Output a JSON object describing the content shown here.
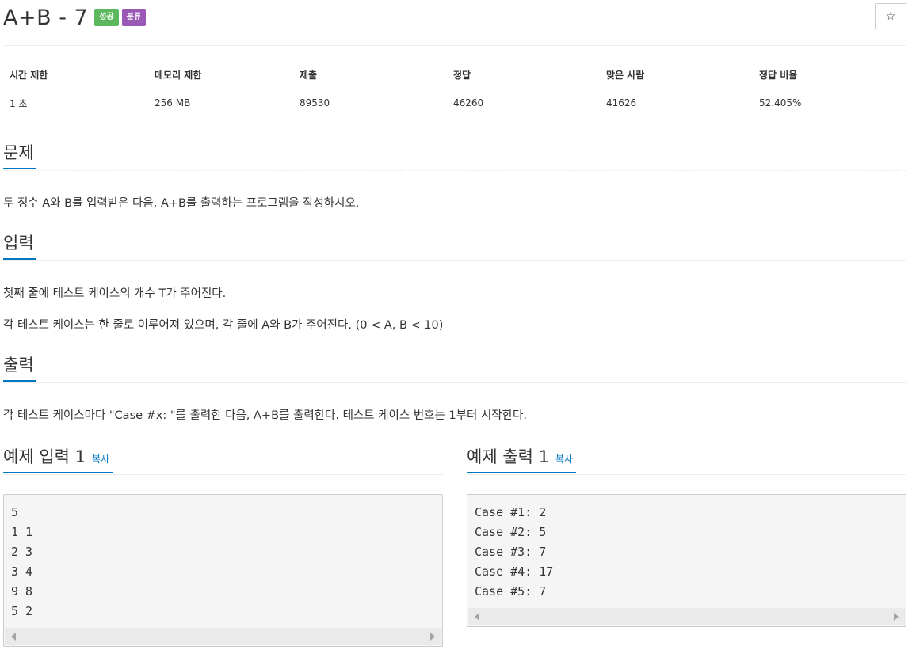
{
  "problem": {
    "title": "A+B - 7",
    "badges": {
      "success": "성공",
      "category": "분류"
    },
    "star_icon": "☆"
  },
  "stats": {
    "headers": [
      "시간 제한",
      "메모리 제한",
      "제출",
      "정답",
      "맞은 사람",
      "정답 비율"
    ],
    "values": [
      "1 초",
      "256 MB",
      "89530",
      "46260",
      "41626",
      "52.405%"
    ]
  },
  "sections": {
    "problem": {
      "heading": "문제",
      "text": "두 정수 A와 B를 입력받은 다음, A+B를 출력하는 프로그램을 작성하시오."
    },
    "input": {
      "heading": "입력",
      "lines": [
        "첫째 줄에 테스트 케이스의 개수 T가 주어진다.",
        "각 테스트 케이스는 한 줄로 이루어져 있으며, 각 줄에 A와 B가 주어진다. (0 < A, B < 10)"
      ]
    },
    "output": {
      "heading": "출력",
      "text": "각 테스트 케이스마다 \"Case #x: \"를 출력한 다음, A+B를 출력한다. 테스트 케이스 번호는 1부터 시작한다."
    }
  },
  "samples": {
    "input": {
      "heading": "예제 입력 1",
      "copy_label": "복사",
      "lines": [
        "5",
        "1 1",
        "2 3",
        "3 4",
        "9 8",
        "5 2"
      ]
    },
    "output": {
      "heading": "예제 출력 1",
      "copy_label": "복사",
      "lines": [
        "Case #1: 2",
        "Case #2: 5",
        "Case #3: 7",
        "Case #4: 17",
        "Case #5: 7"
      ]
    }
  },
  "colors": {
    "accent": "#0076c0",
    "badge_success": "#5cb85c",
    "badge_category": "#9b59b6"
  }
}
